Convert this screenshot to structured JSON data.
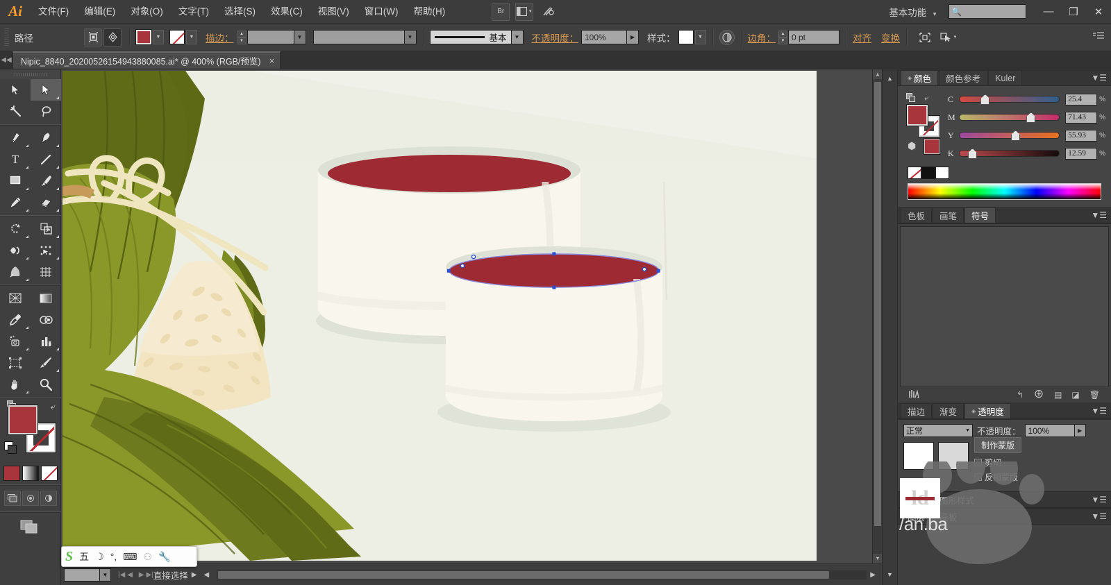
{
  "app": {
    "name": "Adobe Illustrator",
    "logo": "Ai"
  },
  "menubar": {
    "items": [
      {
        "label": "文件(F)",
        "name": "menu-file"
      },
      {
        "label": "编辑(E)",
        "name": "menu-edit"
      },
      {
        "label": "对象(O)",
        "name": "menu-object"
      },
      {
        "label": "文字(T)",
        "name": "menu-type"
      },
      {
        "label": "选择(S)",
        "name": "menu-select"
      },
      {
        "label": "效果(C)",
        "name": "menu-effect"
      },
      {
        "label": "视图(V)",
        "name": "menu-view"
      },
      {
        "label": "窗口(W)",
        "name": "menu-window"
      },
      {
        "label": "帮助(H)",
        "name": "menu-help"
      }
    ],
    "bridge_icon": "Br",
    "arrange_icon": "arrange-documents-icon",
    "stock_icon": "stock-icon",
    "workspace": "基本功能",
    "search_placeholder": "",
    "window_buttons": {
      "minimize": "—",
      "maximize": "❐",
      "close": "✕"
    }
  },
  "controlbar": {
    "object_label": "路径",
    "isolate_icon": "isolate-selected-icon",
    "target_icon": "target-icon",
    "fill_color": "#a8353c",
    "stroke_color": "none",
    "stroke_label": "描边：",
    "stroke_weight": "",
    "stroke_profile": "",
    "brush_label": "基本",
    "opacity_label": "不透明度：",
    "opacity_value": "100%",
    "style_label": "样式：",
    "style_swatch": "#ffffff",
    "recolor_icon": "recolor-artwork-icon",
    "corner_label": "边角：",
    "corner_value": "0 pt",
    "align_label": "对齐",
    "transform_label": "变换",
    "shape_icon": "shape-options-icon",
    "select_similar_icon": "select-similar-icon",
    "panel_menu_icon": "panel-menu-icon"
  },
  "document_tab": {
    "title": "Nipic_8840_20200526154943880085.ai* @ 400% (RGB/预览)",
    "close": "×"
  },
  "toolbar": {
    "tools": [
      {
        "name": "selection-tool",
        "glyph": "➤",
        "active": false,
        "corner": false
      },
      {
        "name": "direct-selection-tool",
        "glyph": "➤",
        "active": true,
        "corner": true
      },
      {
        "name": "magic-wand-tool",
        "glyph": "✳",
        "active": false,
        "corner": false
      },
      {
        "name": "lasso-tool",
        "glyph": "◠",
        "active": false,
        "corner": false
      },
      {
        "name": "pen-tool",
        "glyph": "✒",
        "active": false,
        "corner": true
      },
      {
        "name": "curvature-tool",
        "glyph": "✎",
        "active": false,
        "corner": true
      },
      {
        "name": "type-tool",
        "glyph": "T",
        "active": false,
        "corner": true
      },
      {
        "name": "line-segment-tool",
        "glyph": "╱",
        "active": false,
        "corner": true
      },
      {
        "name": "rectangle-tool",
        "glyph": "▭",
        "active": false,
        "corner": true
      },
      {
        "name": "paintbrush-tool",
        "glyph": "🖌",
        "active": false,
        "corner": true
      },
      {
        "name": "pencil-tool",
        "glyph": "✐",
        "active": false,
        "corner": true
      },
      {
        "name": "eraser-tool",
        "glyph": "▱",
        "active": false,
        "corner": true
      },
      {
        "name": "rotate-tool",
        "glyph": "↻",
        "active": false,
        "corner": true
      },
      {
        "name": "scale-tool",
        "glyph": "⤢",
        "active": false,
        "corner": true
      },
      {
        "name": "width-tool",
        "glyph": "✦",
        "active": false,
        "corner": true
      },
      {
        "name": "shape-builder-tool",
        "glyph": "⬚",
        "active": false,
        "corner": true
      },
      {
        "name": "perspective-grid-tool",
        "glyph": "◳",
        "active": false,
        "corner": true
      },
      {
        "name": "mesh-tool",
        "glyph": "▦",
        "active": false,
        "corner": false
      },
      {
        "name": "gradient-tool",
        "glyph": "▤",
        "active": false,
        "corner": false
      },
      {
        "name": "eyedropper-tool",
        "glyph": "⚲",
        "active": false,
        "corner": true
      },
      {
        "name": "blend-tool",
        "glyph": "◎",
        "active": false,
        "corner": false
      },
      {
        "name": "symbol-sprayer-tool",
        "glyph": "⊛",
        "active": false,
        "corner": true
      },
      {
        "name": "column-graph-tool",
        "glyph": "▥",
        "active": false,
        "corner": true
      },
      {
        "name": "artboard-tool",
        "glyph": "⛶",
        "active": false,
        "corner": false
      },
      {
        "name": "slice-tool",
        "glyph": "✂",
        "active": false,
        "corner": true
      },
      {
        "name": "hand-tool",
        "glyph": "✋",
        "active": false,
        "corner": true
      },
      {
        "name": "zoom-tool",
        "glyph": "🔍",
        "active": false,
        "corner": false
      }
    ],
    "fill_color": "#a8353c",
    "stroke_color": "none",
    "swap_icon": "swap-fill-stroke-icon",
    "default_icon": "default-fill-stroke-icon",
    "modes": [
      {
        "name": "color-mode-button",
        "label": "color"
      },
      {
        "name": "gradient-mode-button",
        "label": "gradient"
      },
      {
        "name": "none-mode-button",
        "label": "none"
      }
    ],
    "screen_modes": [
      {
        "name": "normal-screen-mode-button",
        "glyph": "▣"
      },
      {
        "name": "fullscreen-menubar-mode-button",
        "glyph": "◉"
      },
      {
        "name": "fullscreen-mode-button",
        "glyph": "◑"
      }
    ]
  },
  "canvas": {
    "zoom": "400%",
    "artwork_name": "zongzi-and-bowls-illustration",
    "colors": {
      "background": "#eef0e6",
      "table": "#e9ebe1",
      "bowl_body": "#f7f5ec",
      "bowl_rim": "#dde0d6",
      "bowl_shadow": "#dcdfd3",
      "filling_red": "#9e2a33",
      "leaf_light": "#8d9b2a",
      "leaf_dark": "#5f6b17",
      "rice": "#f2e4c0",
      "string": "#efe6c0"
    },
    "selection": {
      "label": "selected-ellipse-path",
      "anchor_color": "#2a4fd6",
      "path_color": "#7a7ad8"
    }
  },
  "color_panel": {
    "tabs": [
      {
        "label": "颜色",
        "active": true,
        "name": "tab-color"
      },
      {
        "label": "颜色参考",
        "active": false,
        "name": "tab-color-guide"
      },
      {
        "label": "Kuler",
        "active": false,
        "name": "tab-kuler"
      }
    ],
    "fill_color": "#a8353c",
    "channels": [
      {
        "label": "C",
        "value": "25.4",
        "unit": "%",
        "pos": 25.4,
        "gradient": "linear-gradient(to right,#d4493f,#2f5f8c)"
      },
      {
        "label": "M",
        "value": "71.43",
        "unit": "%",
        "pos": 71.43,
        "gradient": "linear-gradient(to right,#b8b86a,#c22d6b)"
      },
      {
        "label": "Y",
        "value": "55.93",
        "unit": "%",
        "pos": 55.93,
        "gradient": "linear-gradient(to right,#9b4a9e,#e8721f)"
      },
      {
        "label": "K",
        "value": "12.59",
        "unit": "%",
        "pos": 12.59,
        "gradient": "linear-gradient(to right,#bd4a4f,#140b0b)"
      }
    ]
  },
  "symbol_panel": {
    "tabs": [
      {
        "label": "色板",
        "active": false,
        "name": "tab-swatches"
      },
      {
        "label": "画笔",
        "active": false,
        "name": "tab-brushes"
      },
      {
        "label": "符号",
        "active": true,
        "name": "tab-symbols"
      }
    ],
    "footer_icons": [
      {
        "name": "symbol-libraries-icon",
        "glyph": "▥"
      },
      {
        "name": "place-symbol-instance-icon",
        "glyph": "↩"
      },
      {
        "name": "break-link-icon",
        "glyph": "⛓"
      },
      {
        "name": "symbol-options-icon",
        "glyph": "▢"
      },
      {
        "name": "new-symbol-icon",
        "glyph": "◪"
      },
      {
        "name": "delete-symbol-icon",
        "glyph": "🗑"
      }
    ]
  },
  "transparency_panel": {
    "tabs": [
      {
        "label": "描边",
        "active": false,
        "name": "tab-stroke"
      },
      {
        "label": "渐变",
        "active": false,
        "name": "tab-gradient"
      },
      {
        "label": "透明度",
        "active": true,
        "name": "tab-transparency"
      }
    ],
    "blend_mode": "正常",
    "opacity_label": "不透明度：",
    "opacity_value": "100%",
    "make_mask_button": "制作蒙版",
    "clip_label": "剪切",
    "invert_label": "反相蒙版"
  },
  "appearance_tabs": [
    {
      "label": "外观",
      "active": false,
      "name": "tab-appearance"
    },
    {
      "label": "图形样式",
      "active": false,
      "name": "tab-graphic-styles"
    }
  ],
  "layers_tabs": [
    {
      "label": "图层",
      "active": false,
      "name": "tab-layers"
    },
    {
      "label": "画板",
      "active": false,
      "name": "tab-artboards"
    }
  ],
  "statusbar": {
    "zoom_value": "",
    "status_text": "直接选择",
    "prev_icon": "previous-artboard-icon",
    "next_icon": "next-artboard-icon"
  },
  "ime": {
    "logo": "S",
    "buttons": [
      {
        "name": "ime-mode-chinese",
        "glyph": "五"
      },
      {
        "name": "ime-moon-icon",
        "glyph": "☽"
      },
      {
        "name": "ime-punctuation-icon",
        "glyph": "°,"
      },
      {
        "name": "ime-keyboard-icon",
        "glyph": "⌨"
      },
      {
        "name": "ime-user-icon",
        "glyph": "⚇"
      },
      {
        "name": "ime-settings-icon",
        "glyph": "🔧"
      }
    ]
  },
  "watermark": {
    "text": "/an.ba",
    "logo": "ld"
  }
}
